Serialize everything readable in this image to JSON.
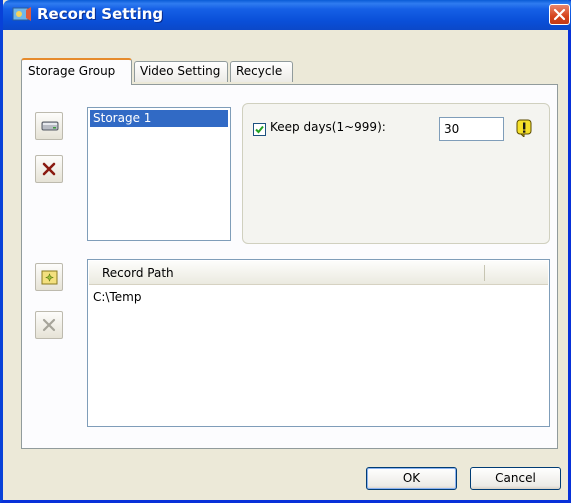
{
  "window": {
    "title": "Record Setting",
    "close_icon": "close-icon"
  },
  "tabs": [
    {
      "label": "Storage Group",
      "active": true
    },
    {
      "label": "Video Setting",
      "active": false
    },
    {
      "label": "Recycle",
      "active": false
    }
  ],
  "storage": {
    "add_icon": "drive-icon",
    "delete_icon": "delete-x-icon",
    "groups": [
      "Storage 1"
    ],
    "selected_index": 0
  },
  "keep_days": {
    "checked": true,
    "label": "Keep days(1~999):",
    "value": "30",
    "warning_icon": "warning-icon"
  },
  "record_path": {
    "add_icon": "new-folder-icon",
    "delete_icon": "delete-x-disabled-icon",
    "column_header": "Record Path",
    "rows": [
      "C:\\Temp"
    ]
  },
  "footer": {
    "ok_label": "OK",
    "cancel_label": "Cancel"
  },
  "colors": {
    "titlebar": "#0a4fd8",
    "selection": "#316ac5",
    "active_tab_accent": "#e68b2c",
    "dialog_bg": "#ece9d8"
  }
}
